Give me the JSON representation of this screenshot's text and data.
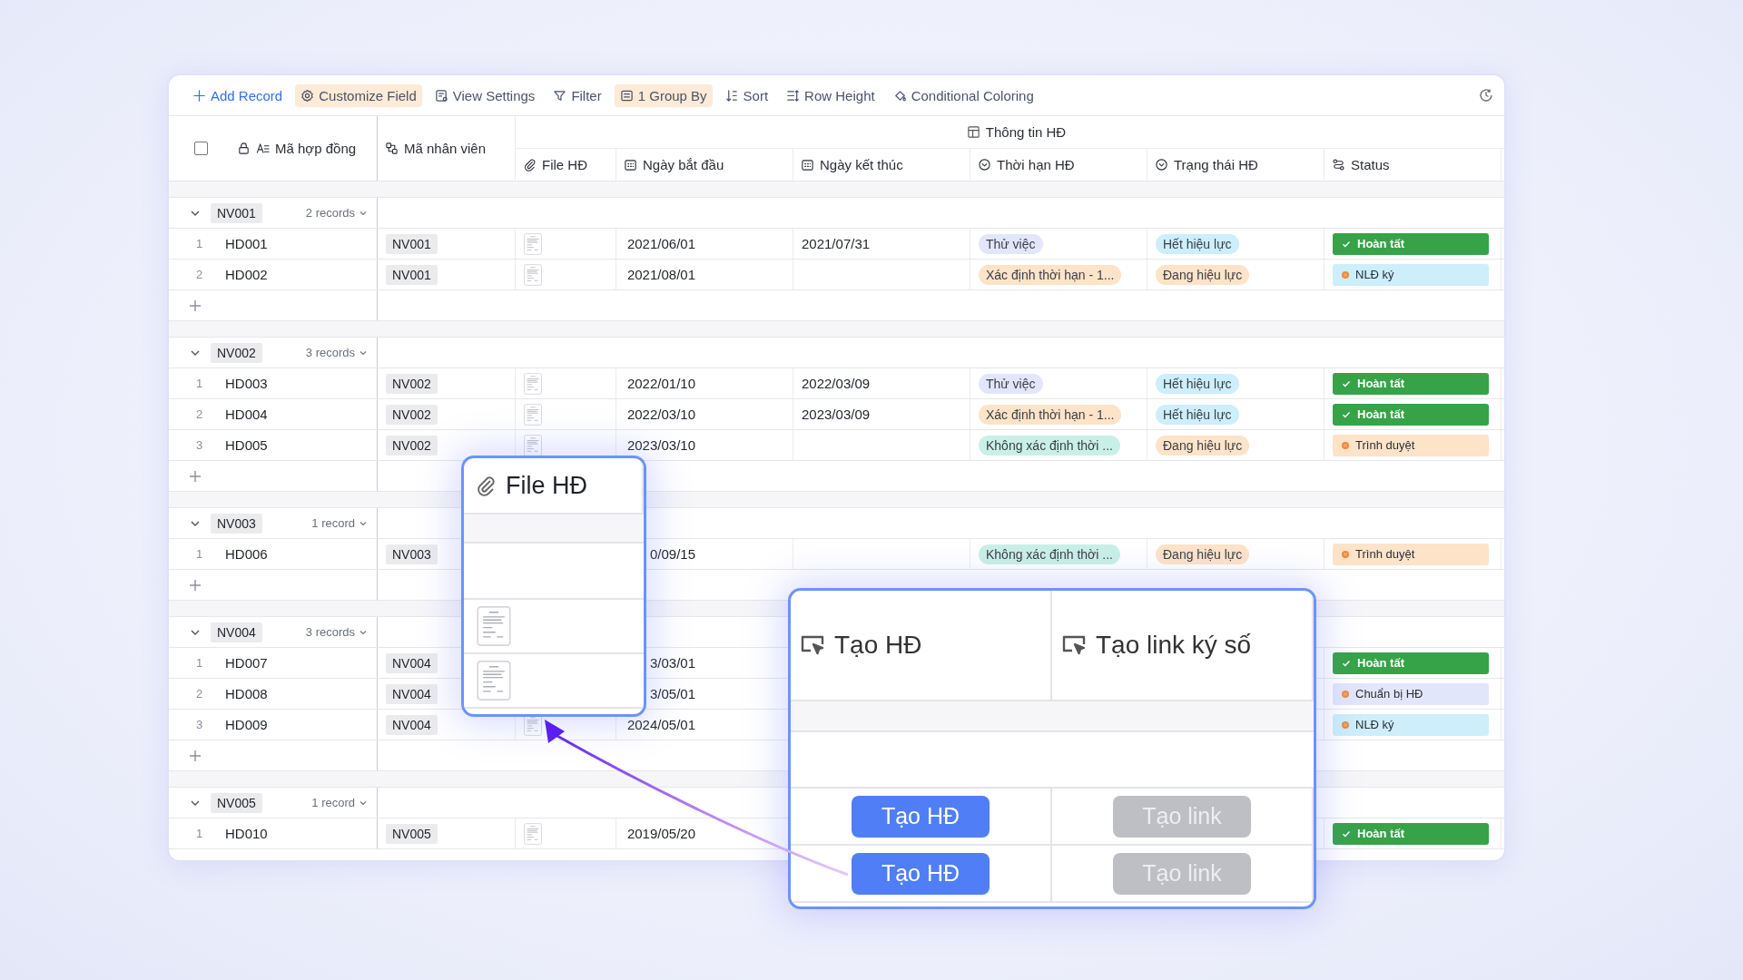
{
  "toolbar": [
    {
      "label": "Add Record",
      "kind": "plus",
      "active": false
    },
    {
      "label": "Customize Field",
      "kind": "gear",
      "active": true
    },
    {
      "label": "View Settings",
      "kind": "view",
      "active": false
    },
    {
      "label": "Filter",
      "kind": "filter",
      "active": false
    },
    {
      "label": "1 Group By",
      "kind": "group",
      "active": true
    },
    {
      "label": "Sort",
      "kind": "sort",
      "active": false
    },
    {
      "label": "Row Height",
      "kind": "height",
      "active": false
    },
    {
      "label": "Conditional Coloring",
      "kind": "coloring",
      "active": false
    }
  ],
  "header": {
    "checked": false,
    "group_label": "Thông tin HĐ",
    "columns": [
      {
        "label": "Mã hợp đồng",
        "kind": "primary"
      },
      {
        "label": "Mã nhân viên",
        "kind": "link"
      },
      {
        "label": "File HĐ",
        "kind": "attachment"
      },
      {
        "label": "Ngày bắt đầu",
        "kind": "date"
      },
      {
        "label": "Ngày kết thúc",
        "kind": "date"
      },
      {
        "label": "Thời hạn HĐ",
        "kind": "select"
      },
      {
        "label": "Trạng thái HĐ",
        "kind": "select"
      },
      {
        "label": "Status",
        "kind": "flow"
      }
    ]
  },
  "groups": [
    {
      "label": "NV001",
      "count": "2 records",
      "expanded": true,
      "rows": [
        {
          "index": "1",
          "code": "HD001",
          "employee": "NV001",
          "file": true,
          "start": "2021/06/01",
          "end": "2021/07/31",
          "term": {
            "label": "Thử việc",
            "color": "#e3e6fb"
          },
          "state": {
            "label": "Hết hiệu lực",
            "color": "#cdeefb"
          },
          "status": {
            "label": "Hoàn tất",
            "kind": "done",
            "color": "#36a348"
          }
        },
        {
          "index": "2",
          "code": "HD002",
          "employee": "NV001",
          "file": true,
          "start": "2021/08/01",
          "term": {
            "label": "Xác định thời hạn - 1...",
            "color": "#fde3c8"
          },
          "state": {
            "label": "Đang hiệu lực",
            "color": "#fde3c8"
          },
          "status": {
            "label": "NLĐ ký",
            "kind": "pending",
            "color": "#cdeefb"
          }
        }
      ]
    },
    {
      "label": "NV002",
      "count": "3 records",
      "expanded": true,
      "rows": [
        {
          "index": "1",
          "code": "HD003",
          "employee": "NV002",
          "file": true,
          "start": "2022/01/10",
          "end": "2022/03/09",
          "term": {
            "label": "Thử việc",
            "color": "#e3e6fb"
          },
          "state": {
            "label": "Hết hiệu lực",
            "color": "#cdeefb"
          },
          "status": {
            "label": "Hoàn tất",
            "kind": "done",
            "color": "#36a348"
          }
        },
        {
          "index": "2",
          "code": "HD004",
          "employee": "NV002",
          "file": true,
          "start": "2022/03/10",
          "end": "2023/03/09",
          "term": {
            "label": "Xác định thời hạn - 1...",
            "color": "#fde3c8"
          },
          "state": {
            "label": "Hết hiệu lực",
            "color": "#cdeefb"
          },
          "status": {
            "label": "Hoàn tất",
            "kind": "done",
            "color": "#36a348"
          }
        },
        {
          "index": "3",
          "code": "HD005",
          "employee": "NV002",
          "file": true,
          "start": "2023/03/10",
          "term": {
            "label": "Không xác định thời ...",
            "color": "#c9f0e6"
          },
          "state": {
            "label": "Đang hiệu lực",
            "color": "#fde3c8"
          },
          "status": {
            "label": "Trình duyệt",
            "kind": "pending",
            "color": "#fde3c8"
          }
        }
      ]
    },
    {
      "label": "NV003",
      "count": "1 record",
      "expanded": true,
      "rows": [
        {
          "index": "1",
          "code": "HD006",
          "employee": "NV003",
          "file": false,
          "start": "0/09/15",
          "term": {
            "label": "Không xác định thời ...",
            "color": "#c9f0e6"
          },
          "state": {
            "label": "Đang hiệu lực",
            "color": "#fde3c8"
          },
          "status": {
            "label": "Trình duyệt",
            "kind": "pending",
            "color": "#fde3c8"
          }
        }
      ]
    },
    {
      "label": "NV004",
      "count": "3 records",
      "expanded": true,
      "rows": [
        {
          "index": "1",
          "code": "HD007",
          "employee": "NV004",
          "file": false,
          "start": "3/03/01",
          "status": {
            "label": "Hoàn tất",
            "kind": "done",
            "color": "#36a348"
          }
        },
        {
          "index": "2",
          "code": "HD008",
          "employee": "NV004",
          "file": false,
          "start": "3/05/01",
          "status": {
            "label": "Chuẩn bị HĐ",
            "kind": "pending",
            "color": "#e2e6fb"
          }
        },
        {
          "index": "3",
          "code": "HD009",
          "employee": "NV004",
          "file": true,
          "start": "2024/05/01",
          "status": {
            "label": "NLĐ ký",
            "kind": "pending",
            "color": "#cdeefb"
          }
        }
      ]
    },
    {
      "label": "NV005",
      "count": "1 record",
      "expanded": true,
      "add_row": false,
      "rows": [
        {
          "index": "1",
          "code": "HD010",
          "employee": "NV005",
          "file": true,
          "start": "2019/05/20",
          "status": {
            "label": "Hoàn tất",
            "kind": "done",
            "color": "#36a348"
          }
        }
      ]
    }
  ],
  "file_panel": {
    "header": "File HĐ",
    "rows": [
      {
        "kind": "group"
      },
      {
        "kind": "record",
        "file": false
      },
      {
        "kind": "record",
        "file": true
      },
      {
        "kind": "record",
        "file": true
      }
    ]
  },
  "action_panel": {
    "headers": [
      "Tạo HĐ",
      "Tạo link ký số"
    ],
    "rows": [
      {
        "kind": "group"
      },
      {
        "kind": "empty"
      },
      {
        "kind": "buttons",
        "buttons": [
          {
            "label": "Tạo HĐ",
            "disabled": false
          },
          {
            "label": "Tạo link",
            "disabled": true
          }
        ]
      },
      {
        "kind": "buttons",
        "buttons": [
          {
            "label": "Tạo HĐ",
            "disabled": false
          },
          {
            "label": "Tạo link",
            "disabled": true
          }
        ]
      }
    ]
  }
}
